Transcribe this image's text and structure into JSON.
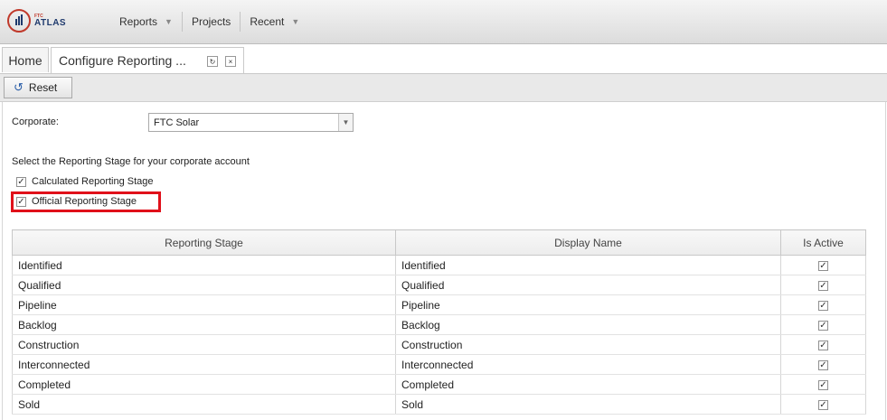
{
  "app": {
    "logo_small": "FTC",
    "logo_name": "ATLAS"
  },
  "nav": {
    "items": [
      {
        "label": "Reports",
        "has_dropdown": true
      },
      {
        "label": "Projects",
        "has_dropdown": false
      },
      {
        "label": "Recent",
        "has_dropdown": true
      }
    ]
  },
  "tabs": {
    "home": "Home",
    "active": "Configure Reporting ...",
    "refresh_icon": "↻",
    "close_icon": "×"
  },
  "toolbar": {
    "reset_label": "Reset",
    "reset_icon": "↺"
  },
  "form": {
    "corporate_label": "Corporate:",
    "corporate_value": "FTC Solar",
    "instructions": "Select the Reporting Stage for your corporate account",
    "options": [
      {
        "label": "Calculated Reporting Stage",
        "checked": true
      },
      {
        "label": "Official Reporting Stage",
        "checked": true,
        "highlighted": true
      }
    ]
  },
  "table": {
    "headers": [
      "Reporting Stage",
      "Display Name",
      "Is Active"
    ],
    "rows": [
      {
        "stage": "Identified",
        "display": "Identified",
        "active": true
      },
      {
        "stage": "Qualified",
        "display": "Qualified",
        "active": true
      },
      {
        "stage": "Pipeline",
        "display": "Pipeline",
        "active": true
      },
      {
        "stage": "Backlog",
        "display": "Backlog",
        "active": true
      },
      {
        "stage": "Construction",
        "display": "Construction",
        "active": true
      },
      {
        "stage": "Interconnected",
        "display": "Interconnected",
        "active": true
      },
      {
        "stage": "Completed",
        "display": "Completed",
        "active": true
      },
      {
        "stage": "Sold",
        "display": "Sold",
        "active": true
      }
    ]
  },
  "colors": {
    "highlight": "#e0101a",
    "logo_red": "#c0392b",
    "logo_navy": "#1f3a6d"
  }
}
